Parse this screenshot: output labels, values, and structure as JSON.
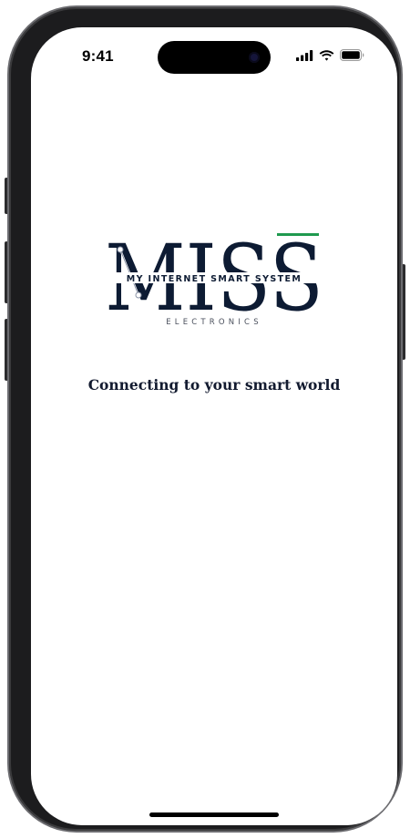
{
  "status_bar": {
    "time": "9:41",
    "icons": [
      "cellular-signal-icon",
      "wifi-icon",
      "battery-icon"
    ]
  },
  "logo": {
    "wordmark": "MISS",
    "subtitle": "MY INTERNET SMART SYSTEM",
    "brand_line": "ELECTRONICS",
    "colors": {
      "navy": "#0d1b33",
      "accent_green": "#1f9a4f"
    }
  },
  "tagline": "Connecting to your smart world",
  "colors": {
    "screen_background": "#ffffff",
    "text_dark": "#121a2f",
    "device_frame": "#1c1c1e"
  }
}
